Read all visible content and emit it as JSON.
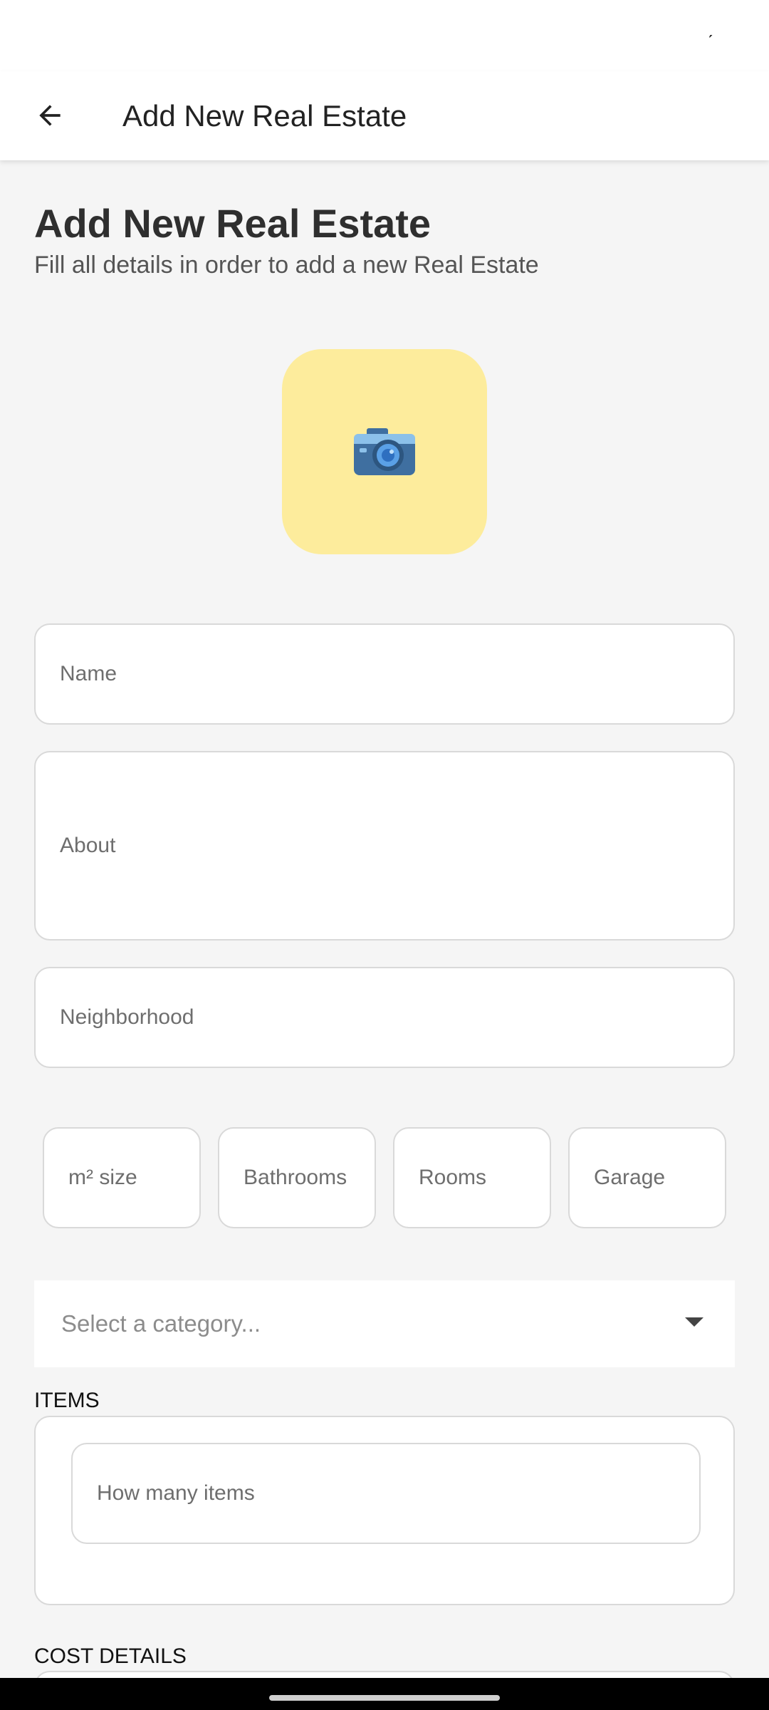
{
  "status_bar": {
    "mark": "ˊ"
  },
  "app_bar": {
    "title": "Add New Real Estate",
    "back_icon": "arrow-left-icon"
  },
  "header": {
    "title": "Add New Real Estate",
    "subtitle": "Fill all details in order to add a new Real Estate"
  },
  "photo_picker": {
    "icon": "camera-icon",
    "background": "#fdec9c"
  },
  "form": {
    "name_placeholder": "Name",
    "about_placeholder": "About",
    "neighborhood_placeholder": "Neighborhood",
    "size_placeholder": "m² size",
    "bathrooms_placeholder": "Bathrooms",
    "rooms_placeholder": "Rooms",
    "garage_placeholder": "Garage",
    "category_placeholder": "Select a category..."
  },
  "items_section": {
    "label": "ITEMS",
    "count_placeholder": "How many items"
  },
  "cost_section": {
    "label": "COST DETAILS"
  }
}
